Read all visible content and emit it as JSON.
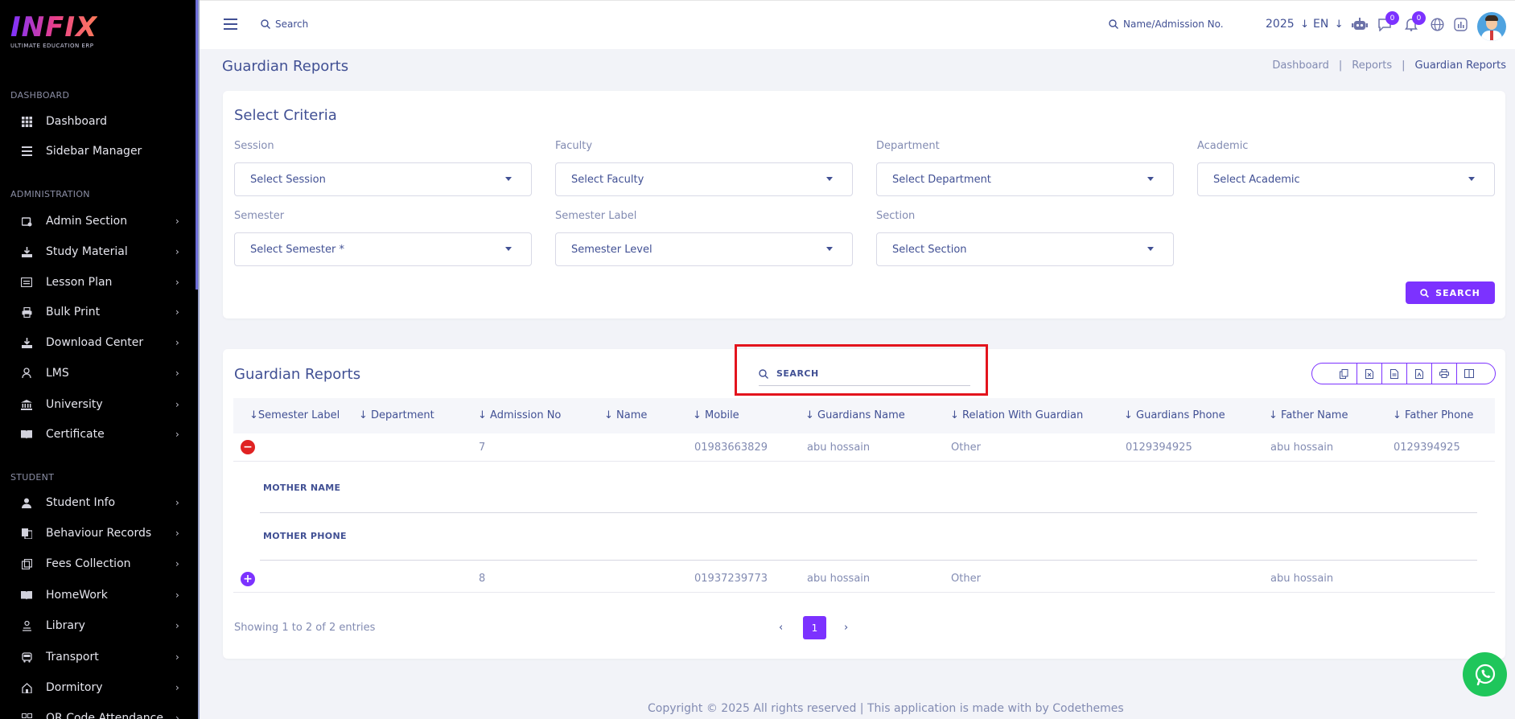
{
  "app": {
    "logo_text": "INFIX",
    "logo_sub": "ULTIMATE EDUCATION ERP"
  },
  "sidebar": {
    "sections": [
      {
        "label": "DASHBOARD"
      },
      {
        "label": "ADMINISTRATION"
      },
      {
        "label": "STUDENT"
      }
    ],
    "items": [
      {
        "label": "Dashboard",
        "icon": "grid-icon"
      },
      {
        "label": "Sidebar Manager",
        "icon": "bars-icon"
      },
      {
        "label": "Admin Section",
        "icon": "admin-icon"
      },
      {
        "label": "Study Material",
        "icon": "download-icon"
      },
      {
        "label": "Lesson Plan",
        "icon": "lesson-icon"
      },
      {
        "label": "Bulk Print",
        "icon": "print-icon"
      },
      {
        "label": "Download Center",
        "icon": "download-icon"
      },
      {
        "label": "LMS",
        "icon": "lms-icon"
      },
      {
        "label": "University",
        "icon": "university-icon"
      },
      {
        "label": "Certificate",
        "icon": "book-icon"
      },
      {
        "label": "Student Info",
        "icon": "user-icon"
      },
      {
        "label": "Behaviour Records",
        "icon": "records-icon"
      },
      {
        "label": "Fees Collection",
        "icon": "fees-icon"
      },
      {
        "label": "HomeWork",
        "icon": "book-icon"
      },
      {
        "label": "Library",
        "icon": "library-icon"
      },
      {
        "label": "Transport",
        "icon": "transport-icon"
      },
      {
        "label": "Dormitory",
        "icon": "dormitory-icon"
      },
      {
        "label": "QR Code Attendance",
        "icon": "qr-icon"
      }
    ]
  },
  "topbar": {
    "search_label": "Search",
    "admission_search_label": "Name/Admission No.",
    "year": "2025",
    "language": "EN",
    "chat_badge": "0",
    "notif_badge": "0"
  },
  "page": {
    "title": "Guardian Reports",
    "breadcrumbs": [
      "Dashboard",
      "Reports",
      "Guardian Reports"
    ],
    "breadcrumb_sep": "|"
  },
  "criteria": {
    "title": "Select Criteria",
    "fields": [
      {
        "label": "Session",
        "value": "Select Session"
      },
      {
        "label": "Faculty",
        "value": "Select Faculty"
      },
      {
        "label": "Department",
        "value": "Select Department"
      },
      {
        "label": "Academic",
        "value": "Select Academic"
      },
      {
        "label": "Semester",
        "value": "Select Semester *"
      },
      {
        "label": "Semester Label",
        "value": "Semester Level"
      },
      {
        "label": "Section",
        "value": "Select Section"
      }
    ],
    "search_button": "SEARCH"
  },
  "report": {
    "title": "Guardian Reports",
    "search_placeholder": "SEARCH",
    "columns": [
      "Semester Label",
      "Department",
      "Admission No",
      "Name",
      "Mobile",
      "Guardians Name",
      "Relation With Guardian",
      "Guardians Phone",
      "Father Name",
      "Father Phone"
    ],
    "rows": [
      {
        "semester_label": "",
        "department": "",
        "admission_no": "7",
        "name": "",
        "mobile": "01983663829",
        "guardians_name": "abu hossain",
        "relation": "Other",
        "guardians_phone": "0129394925",
        "father_name": "abu hossain",
        "father_phone": "0129394925",
        "expanded": true
      },
      {
        "semester_label": "",
        "department": "",
        "admission_no": "8",
        "name": "",
        "mobile": "01937239773",
        "guardians_name": "abu hossain",
        "relation": "Other",
        "guardians_phone": "",
        "father_name": "abu hossain",
        "father_phone": "",
        "expanded": false
      }
    ],
    "child_fields": [
      {
        "label": "MOTHER NAME",
        "value": ""
      },
      {
        "label": "MOTHER PHONE",
        "value": ""
      }
    ],
    "showing": "Showing 1 to 2 of 2 entries",
    "current_page": "1"
  },
  "footer": {
    "text": "Copyright © 2025 All rights reserved | This application is made with by Codethemes"
  },
  "colors": {
    "accent": "#7c32ff",
    "text": "#415094",
    "muted": "#828bb2",
    "whatsapp": "#1fc65b",
    "highlight": "#e3141d"
  }
}
